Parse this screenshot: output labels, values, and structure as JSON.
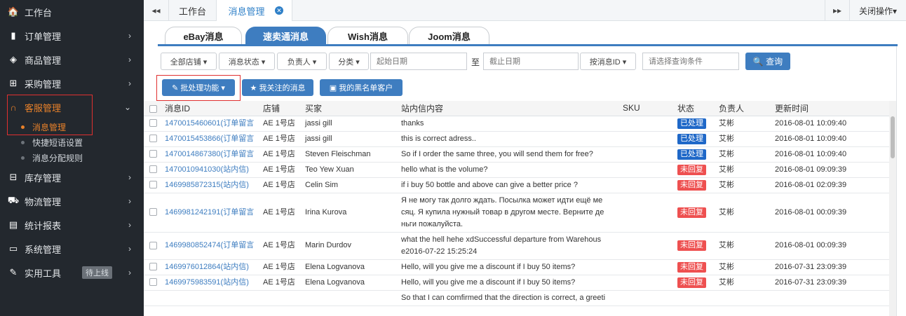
{
  "sidebar": {
    "items": [
      {
        "icon": "home-icon",
        "glyph": "🏠",
        "label": "工作台",
        "arrow": ""
      },
      {
        "icon": "clipboard-icon",
        "glyph": "▮",
        "label": "订单管理",
        "arrow": "›"
      },
      {
        "icon": "cube-icon",
        "glyph": "◈",
        "label": "商品管理",
        "arrow": "›"
      },
      {
        "icon": "cart-icon",
        "glyph": "⊞",
        "label": "采购管理",
        "arrow": "›"
      },
      {
        "icon": "headset-icon",
        "glyph": "∩",
        "label": "客服管理",
        "arrow": "⌄"
      }
    ],
    "sub_items": [
      {
        "label": "消息管理"
      },
      {
        "label": "快捷短语设置"
      },
      {
        "label": "消息分配规则"
      }
    ],
    "items2": [
      {
        "icon": "database-icon",
        "glyph": "⊟",
        "label": "库存管理",
        "arrow": "›"
      },
      {
        "icon": "truck-icon",
        "glyph": "⛟",
        "label": "物流管理",
        "arrow": "›"
      },
      {
        "icon": "report-icon",
        "glyph": "▤",
        "label": "统计报表",
        "arrow": "›"
      },
      {
        "icon": "monitor-icon",
        "glyph": "▭",
        "label": "系统管理",
        "arrow": "›"
      },
      {
        "icon": "wrench-icon",
        "glyph": "✎",
        "label": "实用工具",
        "arrow": "›",
        "badge": "待上线"
      }
    ]
  },
  "topbar": {
    "back_glyph": "◂◂",
    "tab1": "工作台",
    "tab2": "消息管理",
    "forward_glyph": "▸▸",
    "close_ops": "关闭操作▾"
  },
  "subtabs": [
    "eBay消息",
    "速卖通消息",
    "Wish消息",
    "Joom消息"
  ],
  "filters": {
    "store": "全部店铺 ▾",
    "status": "消息状态 ▾",
    "owner": "负责人 ▾",
    "category": "分类 ▾",
    "start_placeholder": "起始日期",
    "to_label": "至",
    "end_placeholder": "截止日期",
    "by_id": "按消息ID ▾",
    "query_placeholder": "请选择查询条件",
    "search": "🔍 查询"
  },
  "actions": {
    "batch": "✎ 批处理功能 ▾",
    "followed": "★ 我关注的消息",
    "blacklist": "▣ 我的黑名单客户"
  },
  "table": {
    "headers": [
      "消息ID",
      "店铺",
      "买家",
      "站内信内容",
      "SKU",
      "状态",
      "负责人",
      "更新时间"
    ],
    "rows": [
      {
        "id": "1470015460601(订单留言",
        "store": "AE 1号店",
        "buyer": "jassi gill",
        "content": "thanks",
        "sku": "",
        "status": "已处理",
        "done": true,
        "owner": "艾彬",
        "time": "2016-08-01 10:09:40"
      },
      {
        "id": "1470015453866(订单留言",
        "store": "AE 1号店",
        "buyer": "jassi gill",
        "content": "this is correct adress..",
        "sku": "",
        "status": "已处理",
        "done": true,
        "owner": "艾彬",
        "time": "2016-08-01 10:09:40"
      },
      {
        "id": "1470014867380(订单留言",
        "store": "AE 1号店",
        "buyer": "Steven Fleischman",
        "content": "So if I order the same three, you will send them for free?",
        "sku": "",
        "status": "已处理",
        "done": true,
        "owner": "艾彬",
        "time": "2016-08-01 10:09:40"
      },
      {
        "id": "1470010941030(站内信)",
        "store": "AE 1号店",
        "buyer": "Teo Yew Xuan",
        "content": "hello what is the volume?",
        "sku": "",
        "status": "未回复",
        "done": false,
        "owner": "艾彬",
        "time": "2016-08-01 09:09:39"
      },
      {
        "id": "1469985872315(站内信)",
        "store": "AE 1号店",
        "buyer": "Celin Sim",
        "content": "if i buy 50 bottle and above can give a better price ?",
        "sku": "",
        "status": "未回复",
        "done": false,
        "owner": "艾彬",
        "time": "2016-08-01 02:09:39"
      },
      {
        "id": "1469981242191(订单留言",
        "store": "AE 1号店",
        "buyer": "Irina Kurova",
        "content": "Я не могу так долго ждать. Посылка может идти ещё ме сяц. Я купила нужный товар в другом месте. Верните де ньги пожалуйста.",
        "sku": "",
        "status": "未回复",
        "done": false,
        "owner": "艾彬",
        "time": "2016-08-01 00:09:39"
      },
      {
        "id": "1469980852474(订单留言",
        "store": "AE 1号店",
        "buyer": "Marin Durdov",
        "content": "what the hell hehe xdSuccessful departure from Warehous e2016-07-22 15:25:24",
        "sku": "",
        "status": "未回复",
        "done": false,
        "owner": "艾彬",
        "time": "2016-08-01 00:09:39"
      },
      {
        "id": "1469976012864(站内信)",
        "store": "AE 1号店",
        "buyer": "Elena Logvanova",
        "content": "Hello, will you give me a discount if I buy 50 items?",
        "sku": "",
        "status": "未回复",
        "done": false,
        "owner": "艾彬",
        "time": "2016-07-31 23:09:39"
      },
      {
        "id": "1469975983591(站内信)",
        "store": "AE 1号店",
        "buyer": "Elena Logvanova",
        "content": "Hello, will you give me a discount if I buy 50 items?",
        "sku": "",
        "status": "未回复",
        "done": false,
        "owner": "艾彬",
        "time": "2016-07-31 23:09:39"
      },
      {
        "id": "",
        "store": "",
        "buyer": "",
        "content": "So that I can comfirmed that the direction is correct, a greeti",
        "sku": "",
        "status": "",
        "done": false,
        "owner": "",
        "time": ""
      }
    ]
  },
  "colors": {
    "sidebar_bg": "#23282e",
    "accent_orange": "#e8812a",
    "primary_blue": "#3e7dc0",
    "status_done": "#1f68c8",
    "status_pending": "#ee5050",
    "highlight_border": "#e03030"
  }
}
